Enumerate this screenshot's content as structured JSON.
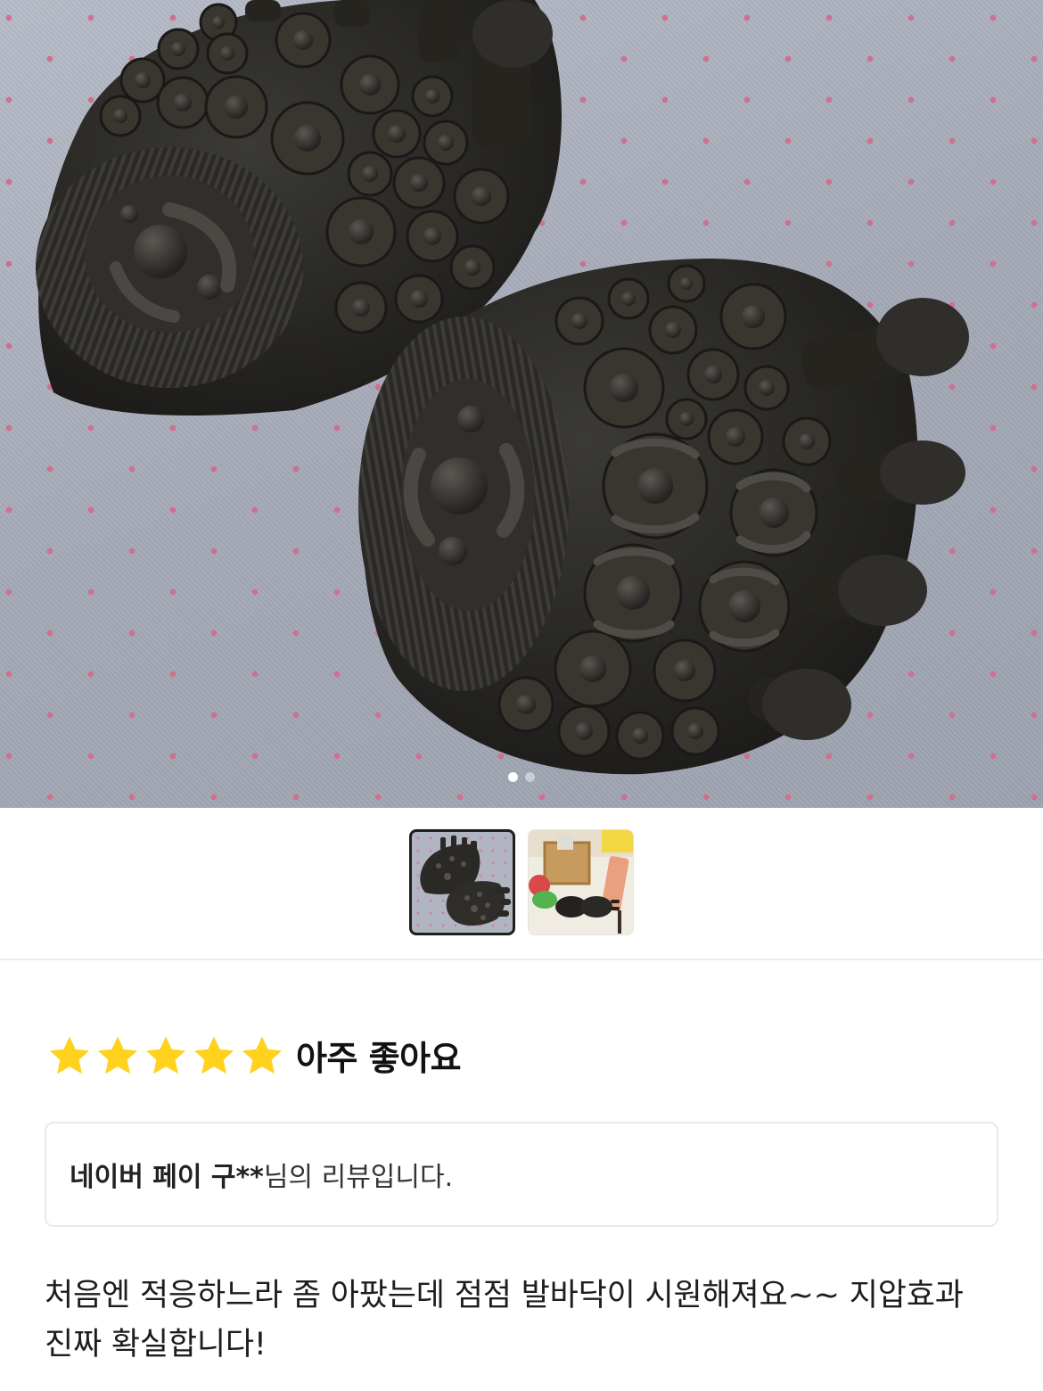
{
  "gallery": {
    "main_image_alt": "Black silicone foot acupressure pads with massage nubs and toe separators",
    "carousel_total": 2,
    "carousel_current": 1,
    "thumbnails": [
      {
        "alt": "acupressure pads on grey fabric",
        "selected": true
      },
      {
        "alt": "pads shown with household items",
        "selected": false
      }
    ]
  },
  "review": {
    "rating": 5,
    "rating_max": 5,
    "star_color": "#ffd21f",
    "rating_label": "아주 좋아요",
    "source": {
      "reviewer": "네이버 페이 구**",
      "suffix": "님의 리뷰입니다."
    },
    "body": "처음엔 적응하느라 좀 아팠는데 점점 발바닥이 시원해져요~~ 지압효과 진짜 확실합니다!"
  }
}
